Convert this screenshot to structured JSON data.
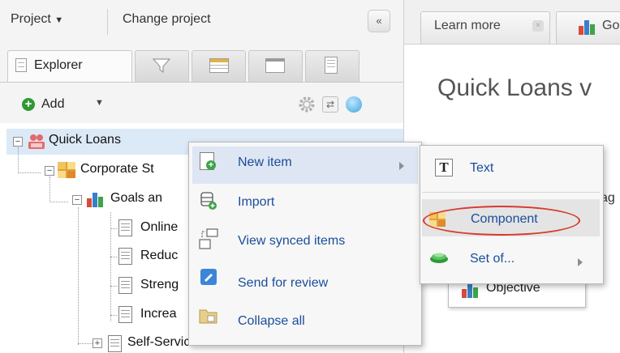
{
  "left_panel": {
    "header": {
      "project_label": "Project",
      "change_project_label": "Change project",
      "collapse_glyph": "«"
    },
    "tabs": [
      {
        "label": "Explorer",
        "icon": "page-icon"
      },
      {
        "label": "",
        "icon": "filter-icon"
      },
      {
        "label": "",
        "icon": "table-icon"
      },
      {
        "label": "",
        "icon": "window-icon"
      },
      {
        "label": "",
        "icon": "clipboard-icon"
      }
    ],
    "toolbar": {
      "add_label": "Add",
      "icons": [
        "gear-icon",
        "sync-icon",
        "globe-icon"
      ]
    },
    "tree": [
      {
        "label": "Quick Loans",
        "icon": "project-icon",
        "selected": true
      },
      {
        "label": "Corporate St",
        "icon": "component-icon"
      },
      {
        "label": "Goals an",
        "icon": "chart-icon"
      },
      {
        "label": "Online",
        "icon": "document-icon"
      },
      {
        "label": "Reduc",
        "icon": "document-icon"
      },
      {
        "label": "Streng",
        "icon": "document-icon"
      },
      {
        "label": "Increa",
        "icon": "document-icon"
      },
      {
        "label": "Self-Service",
        "icon": "document-icon"
      }
    ]
  },
  "right_panel": {
    "tabs": [
      {
        "label": "Learn more"
      },
      {
        "label": "Go"
      }
    ],
    "title": "Quick Loans v",
    "partial_text": "ag",
    "objective_label": "Objective"
  },
  "context_menu": {
    "items": [
      {
        "label": "New item",
        "icon": "new-document-icon",
        "has_submenu": true
      },
      {
        "label": "Import",
        "icon": "import-icon"
      },
      {
        "label": "View synced items",
        "icon": "synced-items-icon"
      },
      {
        "label": "Send for review",
        "icon": "review-icon"
      },
      {
        "label": "Collapse all",
        "icon": "folder-icon"
      }
    ]
  },
  "submenu": {
    "items": [
      {
        "label": "Text",
        "icon": "text-icon",
        "glyph": "T"
      },
      {
        "label": "Component",
        "icon": "component-icon",
        "highlighted": true
      },
      {
        "label": "Set of...",
        "icon": "set-icon",
        "has_submenu": true
      }
    ]
  },
  "colors": {
    "accent_blue": "#1a4d9c",
    "highlight_ring": "#d83a2e",
    "selection": "#dce9f7",
    "add_green": "#2e9a34"
  }
}
